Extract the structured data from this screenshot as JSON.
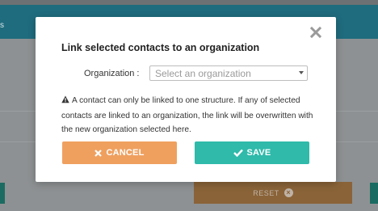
{
  "background": {
    "header_fragment": "s",
    "reset_label": "RESET"
  },
  "modal": {
    "title": "Link selected contacts to an organization",
    "organization_label": "Organization :",
    "organization_placeholder": "Select an organization",
    "warning_text": "A contact can only be linked to one structure. If any of selected contacts are linked to an organization, the link will be overwritten with the new organization selected here.",
    "cancel_label": "CANCEL",
    "save_label": "SAVE"
  },
  "icons": {
    "close": "close-icon",
    "warning": "warning-icon",
    "cancel": "x-icon",
    "save": "check-icon",
    "caret": "caret-down-icon",
    "reset": "x-circle-icon"
  },
  "colors": {
    "header": "#1f6c7e",
    "cancel": "#efa05f",
    "save": "#2fbaaa",
    "reset": "#8a6338"
  }
}
